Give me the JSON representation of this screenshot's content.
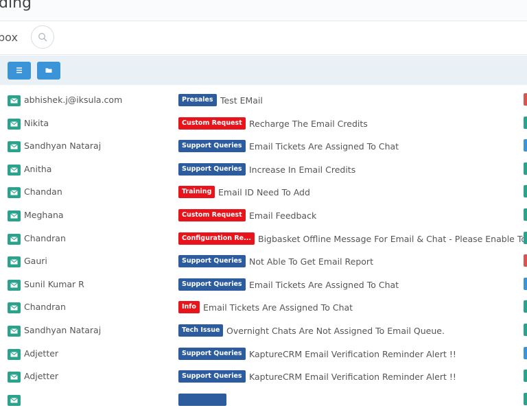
{
  "header": {
    "title": "ding"
  },
  "subheader": {
    "title": "box"
  },
  "colors": {
    "presales": "#2d5c9e",
    "support": "#2d5c9e",
    "custom": "#e8141b",
    "training": "#e8141b",
    "configuration": "#e8141b",
    "info": "#e8141b",
    "tech": "#2d5c9e",
    "status_red": "#d9534f",
    "status_teal": "#2aa38c",
    "status_blue": "#3b93d8"
  },
  "emails": [
    {
      "sender": "abhishek.j@iksula.com",
      "tag": "Presales",
      "tag_color": "#2d5c9e",
      "subject": "Test EMail",
      "status_color": "#d9534f"
    },
    {
      "sender": "Nikita",
      "tag": "Custom Request",
      "tag_color": "#e8141b",
      "subject": "Recharge The Email Credits",
      "status_color": "#2aa38c"
    },
    {
      "sender": "Sandhyan Nataraj",
      "tag": "Support Queries",
      "tag_color": "#2d5c9e",
      "subject": "Email Tickets Are Assigned To Chat",
      "status_color": "#3b93d8"
    },
    {
      "sender": "Anitha",
      "tag": "Support Queries",
      "tag_color": "#2d5c9e",
      "subject": "Increase In Email Credits",
      "status_color": "#2aa38c"
    },
    {
      "sender": "Chandan",
      "tag": "Training",
      "tag_color": "#e8141b",
      "subject": "Email ID Need To Add",
      "status_color": "#2aa38c"
    },
    {
      "sender": "Meghana",
      "tag": "Custom Request",
      "tag_color": "#e8141b",
      "subject": "Email Feedback",
      "status_color": "#2aa38c"
    },
    {
      "sender": "Chandran",
      "tag": "Configuration Re...",
      "tag_color": "#e8141b",
      "subject": "Bigbasket Offline Message For Email & Chat - Please Enable Tom...",
      "status_color": "#2aa38c"
    },
    {
      "sender": "Gauri",
      "tag": "Support Queries",
      "tag_color": "#2d5c9e",
      "subject": "Not Able To Get Email Report",
      "status_color": "#d9534f"
    },
    {
      "sender": "Sunil Kumar R",
      "tag": "Support Queries",
      "tag_color": "#2d5c9e",
      "subject": "Email Tickets Are Assigned To Chat",
      "status_color": "#3b93d8"
    },
    {
      "sender": "Chandran",
      "tag": "Info",
      "tag_color": "#e8141b",
      "subject": "Email Tickets Are Assigned To Chat",
      "status_color": "#2aa38c"
    },
    {
      "sender": "Sandhyan Nataraj",
      "tag": "Tech Issue",
      "tag_color": "#2d5c9e",
      "subject": "Overnight Chats Are Not Assigned To Email Queue.",
      "status_color": "#2aa38c"
    },
    {
      "sender": "Adjetter",
      "tag": "Support Queries",
      "tag_color": "#2d5c9e",
      "subject": "KaptureCRM Email Verification Reminder Alert !!",
      "status_color": "#3b93d8"
    },
    {
      "sender": "Adjetter",
      "tag": "Support Queries",
      "tag_color": "#2d5c9e",
      "subject": "KaptureCRM Email Verification Reminder Alert !!",
      "status_color": "#2aa38c"
    },
    {
      "sender": "",
      "tag": "",
      "tag_color": "#2d5c9e",
      "subject": "",
      "status_color": "#2aa38c"
    }
  ]
}
